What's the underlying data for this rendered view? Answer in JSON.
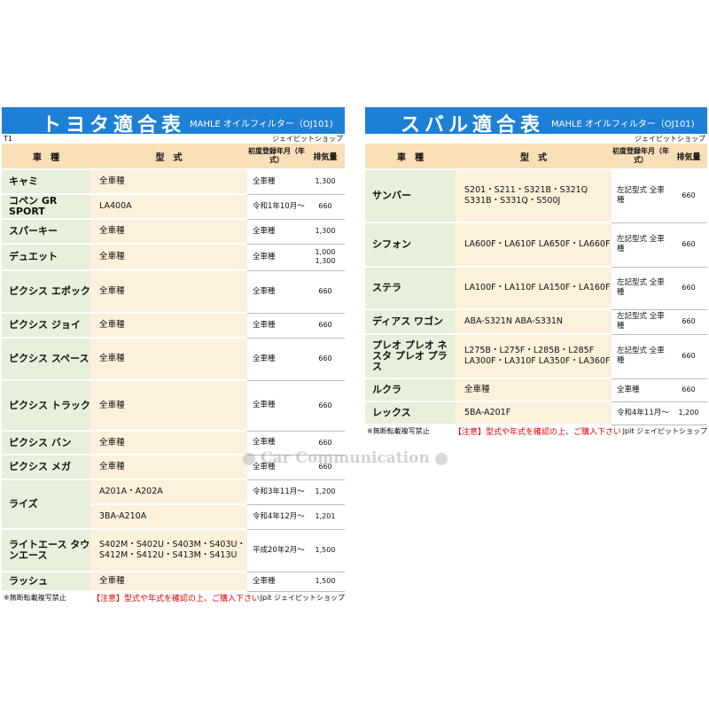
{
  "toyota": {
    "title": "トヨタ適合表",
    "subtitle": "MAHLE オイルフィルター（OJ101)",
    "tag": "T1",
    "shop": "ジェイピットショップ",
    "headers": {
      "model": "車　種",
      "type": "型　式",
      "year": "初度登録年月（年式）",
      "disp": "排気量"
    },
    "rows": [
      {
        "model": "キャミ",
        "type": "全車種",
        "year": "全車種",
        "disp": "1,300"
      },
      {
        "model": "コペン GR SPORT",
        "type": "LA400A",
        "year": "令和1年10月～",
        "disp": "660"
      },
      {
        "model": "スパーキー",
        "type": "全車種",
        "year": "全車種",
        "disp": "1,300"
      },
      {
        "model": "デュエット",
        "type": "全車種",
        "year": "全車種",
        "disp": "1,000 1,300"
      },
      {
        "model": "ピクシス エポック",
        "type": "全車種",
        "year": "全車種",
        "disp": "660"
      },
      {
        "model": "ピクシス ジョイ",
        "type": "全車種",
        "year": "全車種",
        "disp": "660"
      },
      {
        "model": "ピクシス スペース",
        "type": "全車種",
        "year": "全車種",
        "disp": "660"
      },
      {
        "model": "ピクシス トラック",
        "type": "全車種",
        "year": "全車種",
        "disp": "660"
      },
      {
        "model": "ピクシス バン",
        "type": "全車種",
        "year": "全車種",
        "disp": "660"
      },
      {
        "model": "ピクシス メガ",
        "type": "全車種",
        "year": "全車種",
        "disp": "660"
      },
      {
        "model": "ライズ",
        "sub": [
          {
            "type": "A201A・A202A",
            "year": "令和3年11月～",
            "disp": "1,200"
          },
          {
            "type": "3BA-A210A",
            "year": "令和4年12月～",
            "disp": "1,201"
          }
        ]
      },
      {
        "model": "ライトエース タウンエース",
        "type": "S402M・S402U・S403M・S403U・ S412M・S412U・S413M・S413U",
        "year": "平成20年2月～",
        "disp": "1,500"
      },
      {
        "model": "ラッシュ",
        "type": "全車種",
        "year": "全車種",
        "disp": "1,500"
      }
    ],
    "footer": {
      "left": "※無断転載複写禁止",
      "mid": "【注意】型式や年式を確認の上、ご購入下さい",
      "right": "Jpit ジェイピットショップ"
    }
  },
  "subaru": {
    "title": "スバル適合表",
    "subtitle": "MAHLE オイルフィルター（OJ101)",
    "shop": "ジェイピットショップ",
    "headers": {
      "model": "車　種",
      "type": "型　式",
      "year": "初度登録年月（年式）",
      "disp": "排気量"
    },
    "rows": [
      {
        "model": "サンバー",
        "type": "S201・S211・S321B・S321Q S331B・S331Q・S500J",
        "year": "左記型式 全車種",
        "disp": "660"
      },
      {
        "model": "シフォン",
        "type": "LA600F・LA610F LA650F・LA660F",
        "year": "左記型式 全車種",
        "disp": "660"
      },
      {
        "model": "ステラ",
        "type": "LA100F・LA110F LA150F・LA160F",
        "year": "左記型式 全車種",
        "disp": "660"
      },
      {
        "model": "ディアス ワゴン",
        "type": "ABA-S321N ABA-S331N",
        "year": "左記型式 全車種",
        "disp": "660"
      },
      {
        "model": "プレオ プレオ ネスタ プレオ プラス",
        "type": "L275B・L275F・L285B・L285F LA300F・LA310F LA350F・LA360F",
        "year": "左記型式 全車種",
        "disp": "660"
      },
      {
        "model": "ルクラ",
        "type": "全車種",
        "year": "全車種",
        "disp": "660"
      },
      {
        "model": "レックス",
        "type": "5BA-A201F",
        "year": "令和4年11月～",
        "disp": "1,200"
      }
    ],
    "footer": {
      "left": "※無断転載複写禁止",
      "mid": "【注意】型式や年式を確認の上、ご購入下さい",
      "right": "Jpit ジェイピットショップ"
    }
  },
  "watermark": "Car Communication"
}
